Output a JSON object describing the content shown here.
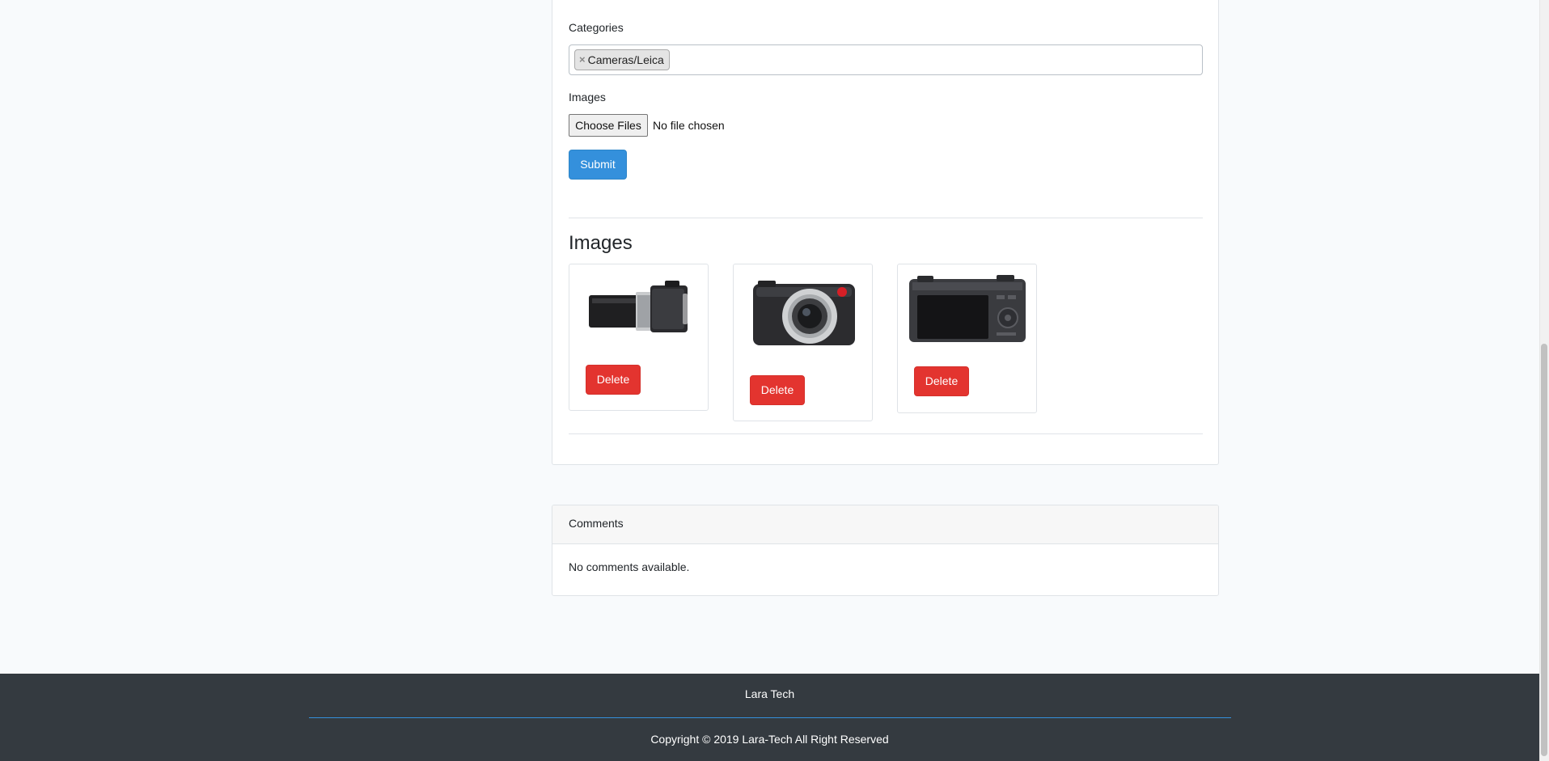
{
  "form": {
    "categories_label": "Categories",
    "selected_categories": [
      {
        "remove_glyph": "×",
        "label": "Cameras/Leica"
      }
    ],
    "images_label": "Images",
    "file_button_label": "Choose Files",
    "file_status": "No file chosen",
    "submit_label": "Submit"
  },
  "images_section": {
    "title": "Images",
    "items": [
      {
        "image": "camera-side-view",
        "delete_label": "Delete"
      },
      {
        "image": "camera-front-view",
        "delete_label": "Delete"
      },
      {
        "image": "camera-back-view",
        "delete_label": "Delete"
      }
    ]
  },
  "comments": {
    "header": "Comments",
    "empty_text": "No comments available."
  },
  "footer": {
    "brand": "Lara Tech",
    "copyright": "Copyright © 2019 Lara-Tech All Right Reserved"
  },
  "colors": {
    "primary": "#3490dc",
    "danger": "#e3342f",
    "footer_bg": "#343a40",
    "page_bg": "#f8fafc"
  }
}
